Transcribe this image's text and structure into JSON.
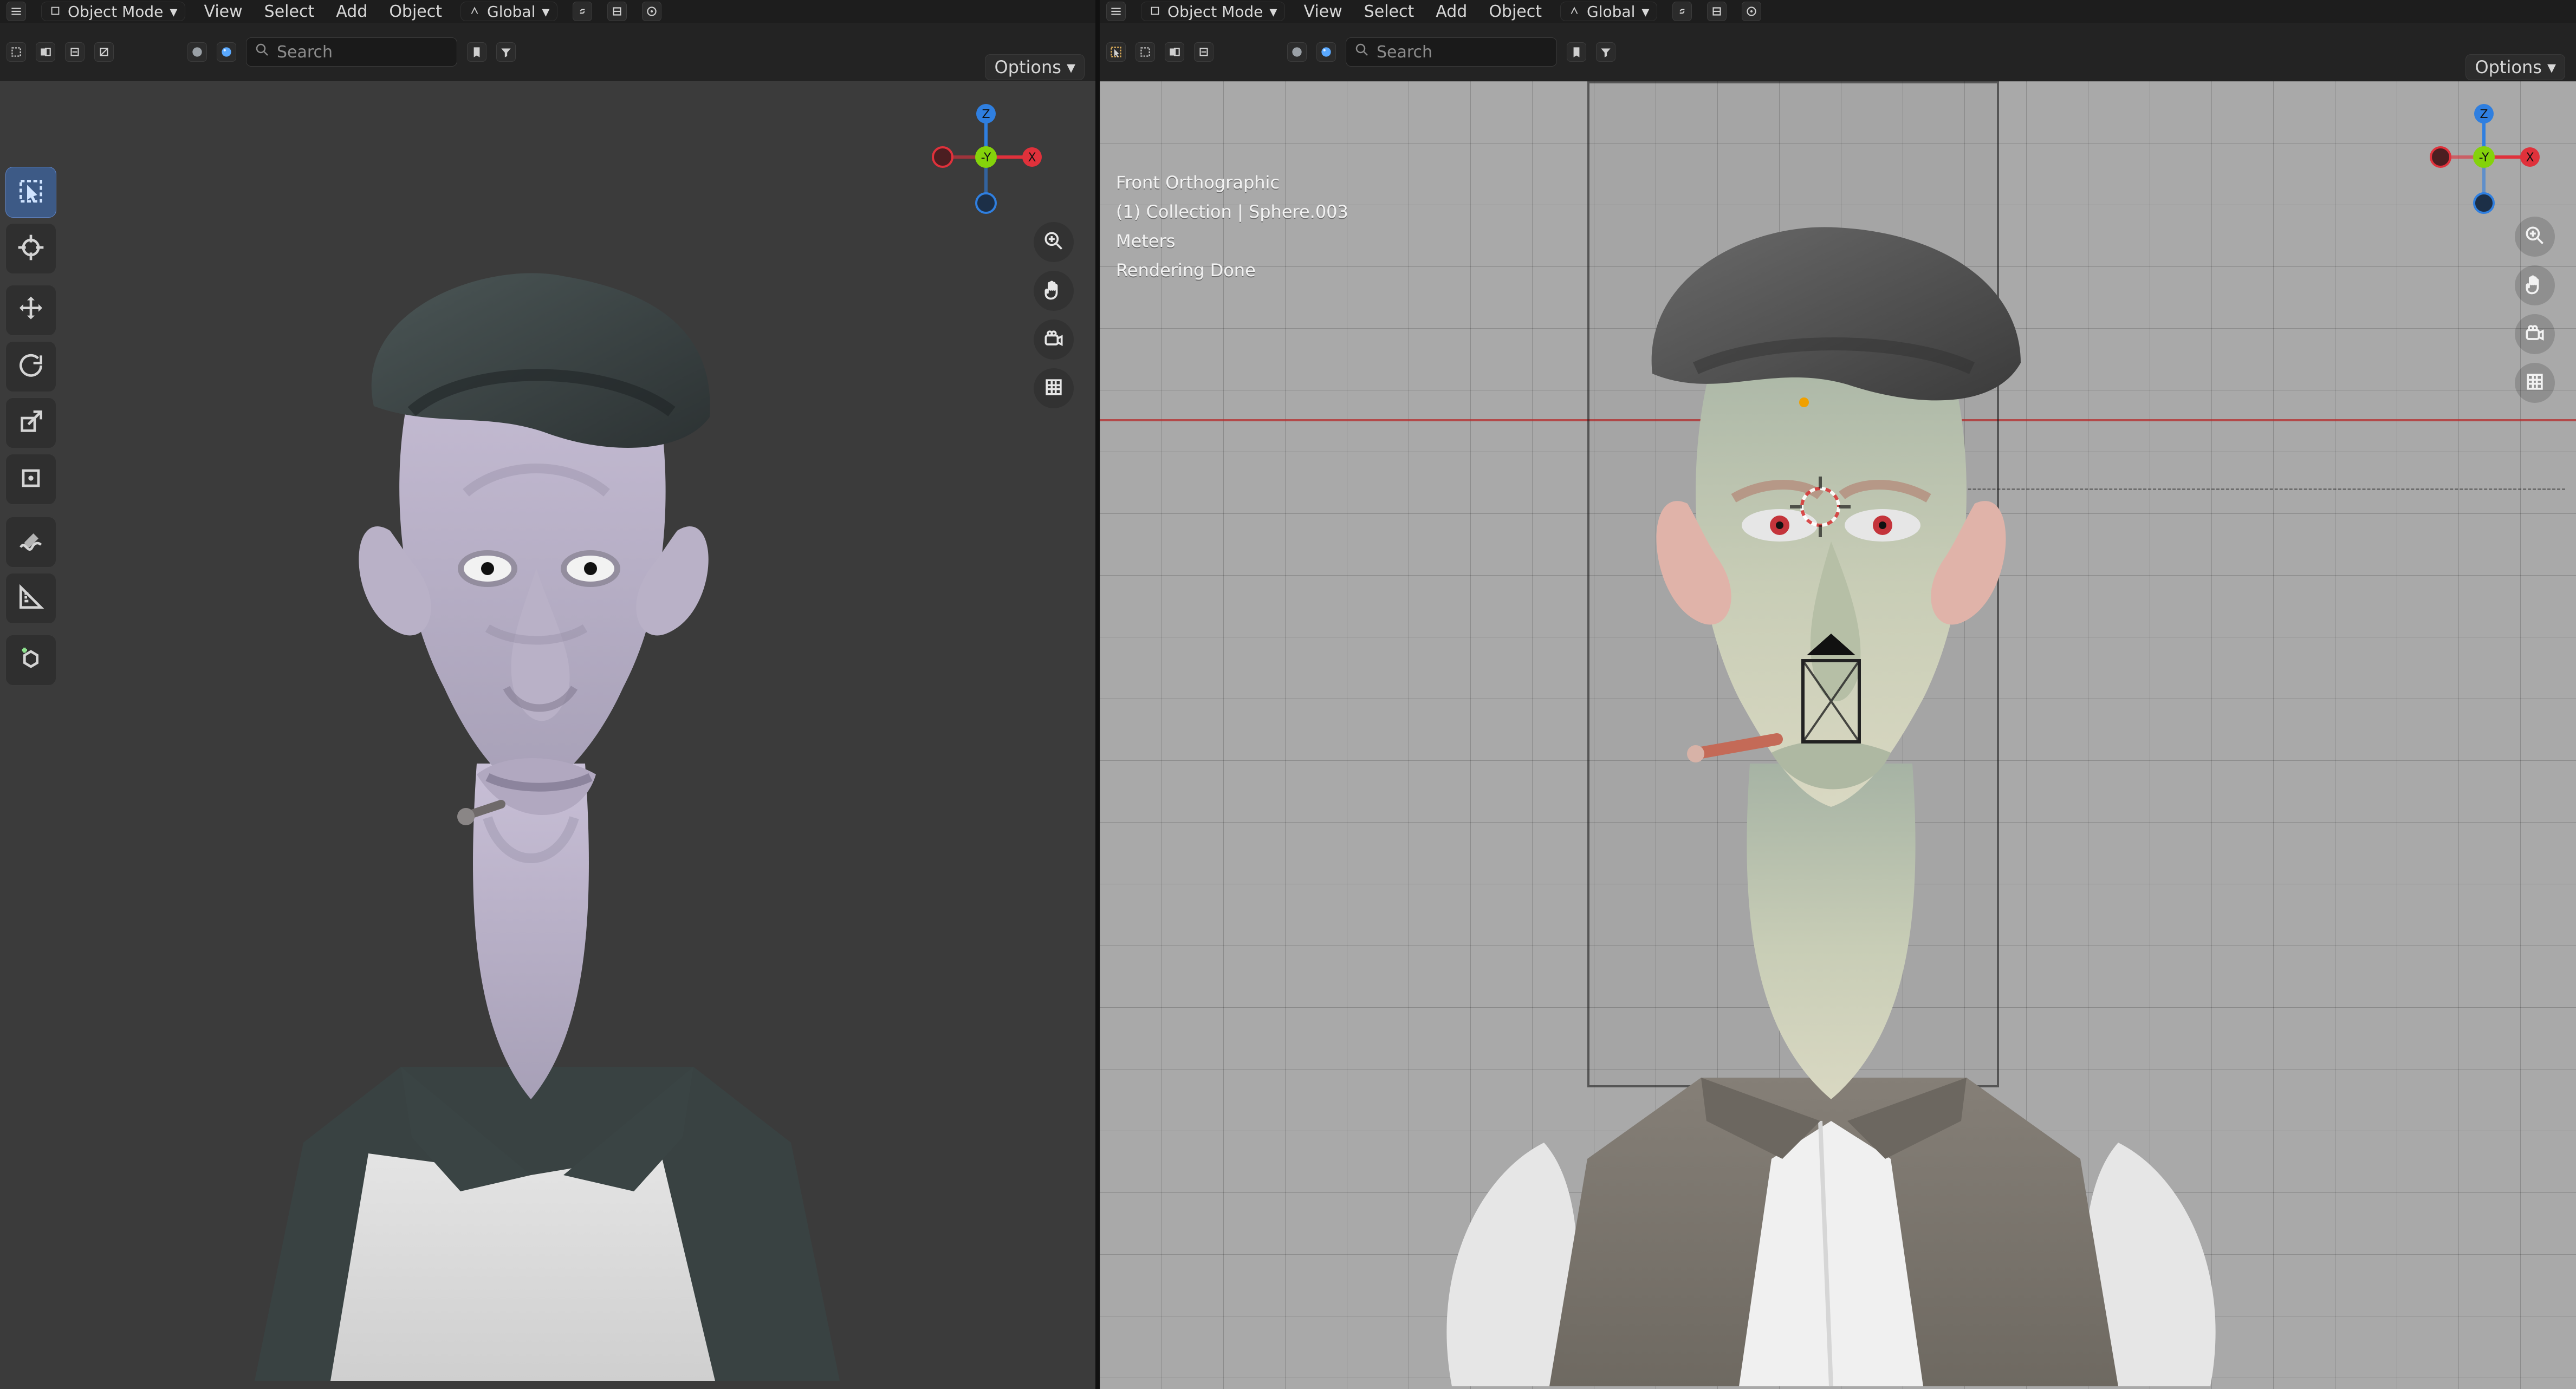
{
  "left": {
    "mode_label": "Object Mode",
    "menu": [
      "View",
      "Select",
      "Add",
      "Object"
    ],
    "orientation_label": "Global",
    "search_placeholder": "Search",
    "options_label": "Options",
    "gizmo": {
      "z": "Z",
      "y": "-Y",
      "x": "X"
    }
  },
  "right": {
    "mode_label": "Object Mode",
    "menu": [
      "View",
      "Select",
      "Add",
      "Object"
    ],
    "orientation_label": "Global",
    "search_placeholder": "Search",
    "options_label": "Options",
    "overlay": [
      "Front Orthographic",
      "(1) Collection | Sphere.003",
      "Meters",
      "Rendering Done"
    ],
    "gizmo": {
      "z": "Z",
      "y": "-Y",
      "x": "X"
    }
  },
  "colors": {
    "x_axis": "#e0313b",
    "y_axis": "#84d20b",
    "z_axis": "#2f7fe0",
    "active_tool": "#3d5a86"
  },
  "icons": [
    "select-icon",
    "cursor-icon",
    "move-icon",
    "rotate-icon",
    "scale-icon",
    "transform-icon",
    "annotate-icon",
    "measure-icon",
    "add-cube-icon",
    "zoom-icon",
    "hand-icon",
    "camera-icon",
    "grid-icon",
    "search-icon",
    "bookmark-icon",
    "filter-icon"
  ]
}
